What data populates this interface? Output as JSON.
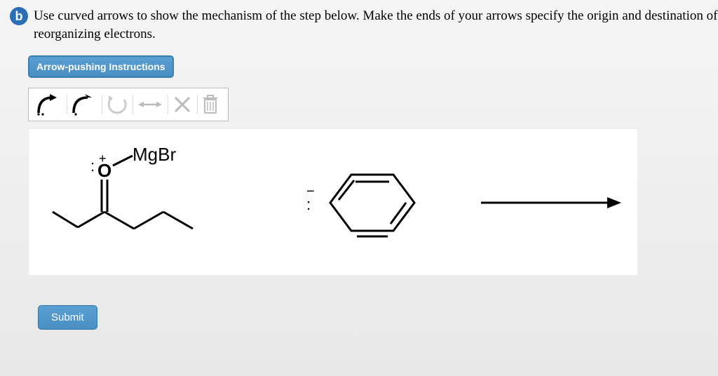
{
  "question": {
    "badge": "b",
    "text": "Use curved arrows to show the mechanism of the step below. Make the ends of your arrows specify the origin and destination of reorganizing electrons."
  },
  "instructions_button": "Arrow-pushing Instructions",
  "toolbar": {
    "full_arrow": "full-curved-arrow",
    "half_arrow": "half-curved-arrow",
    "undo": "undo",
    "resonance": "resonance-arrow",
    "clear": "clear",
    "trash": "trash"
  },
  "reaction": {
    "oxygen_label": ":O",
    "charge": "+",
    "mgbr": "MgBr",
    "benzene_charge": ":",
    "benzene_minus": "−"
  },
  "submit_button": "Submit"
}
